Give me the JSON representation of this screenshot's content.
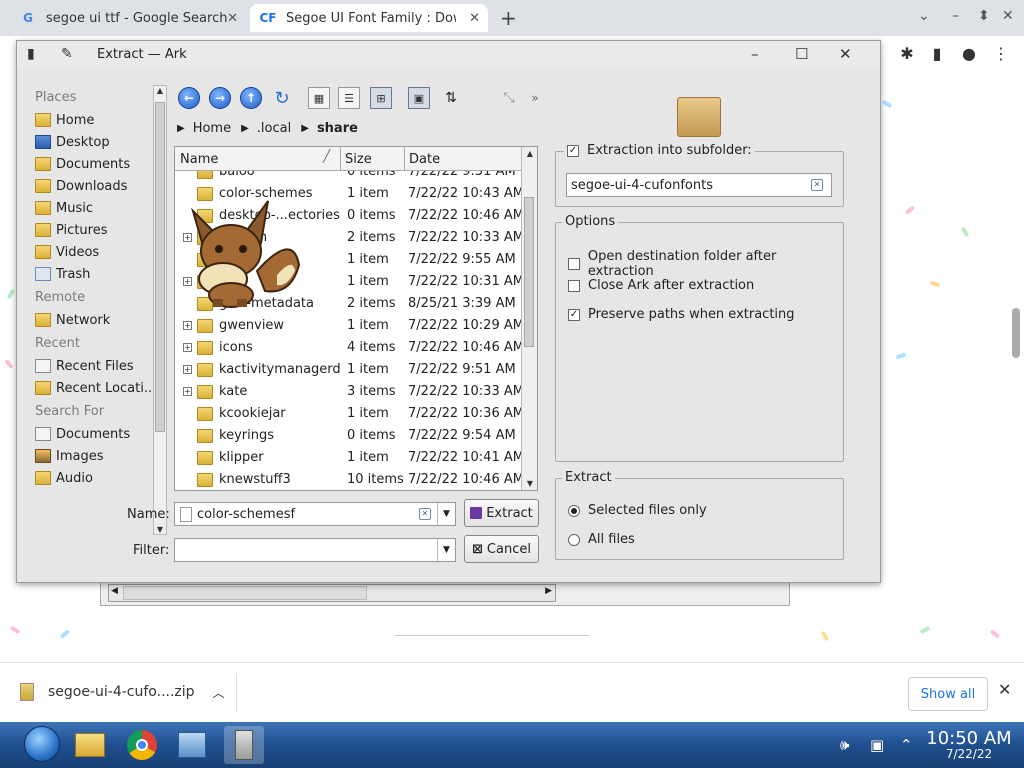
{
  "browser": {
    "tabs": [
      {
        "icon": "G",
        "title": "segoe ui ttf - Google Search"
      },
      {
        "icon": "CF",
        "title": "Segoe UI Font Family : Down"
      }
    ],
    "new_tab": "+"
  },
  "dialog": {
    "title": "Extract — Ark",
    "places": {
      "sections": [
        {
          "label": "Places",
          "items": [
            {
              "label": "Home",
              "icon": "folder-home-icon"
            },
            {
              "label": "Desktop",
              "icon": "desktop-icon"
            },
            {
              "label": "Documents",
              "icon": "folder-icon"
            },
            {
              "label": "Downloads",
              "icon": "folder-icon"
            },
            {
              "label": "Music",
              "icon": "folder-icon"
            },
            {
              "label": "Pictures",
              "icon": "folder-icon"
            },
            {
              "label": "Videos",
              "icon": "folder-icon"
            },
            {
              "label": "Trash",
              "icon": "trash-icon"
            }
          ]
        },
        {
          "label": "Remote",
          "items": [
            {
              "label": "Network",
              "icon": "folder-icon"
            }
          ]
        },
        {
          "label": "Recent",
          "items": [
            {
              "label": "Recent Files",
              "icon": "document-icon"
            },
            {
              "label": "Recent Locati...",
              "icon": "folder-icon"
            }
          ]
        },
        {
          "label": "Search For",
          "items": [
            {
              "label": "Documents",
              "icon": "document-icon"
            },
            {
              "label": "Images",
              "icon": "image-icon"
            },
            {
              "label": "Audio",
              "icon": "folder-icon"
            }
          ]
        }
      ]
    },
    "breadcrumb": [
      "Home",
      ".local",
      "share"
    ],
    "columns": {
      "name": "Name",
      "size": "Size",
      "date": "Date"
    },
    "files": [
      {
        "name": "baloo",
        "size": "0 items",
        "date": "7/22/22 9:51 AM",
        "expander": false
      },
      {
        "name": "color-schemes",
        "size": "1 item",
        "date": "7/22/22 10:43 AM",
        "expander": false
      },
      {
        "name": "desktop-...ectories",
        "size": "0 items",
        "date": "7/22/22 10:46 AM",
        "expander": false
      },
      {
        "name": "dolphin",
        "size": "2 items",
        "date": "7/22/22 10:33 AM",
        "expander": true
      },
      {
        "name": "",
        "size": "1 item",
        "date": "7/22/22 9:55 AM",
        "expander": false
      },
      {
        "name": "",
        "size": "1 item",
        "date": "7/22/22 10:31 AM",
        "expander": true
      },
      {
        "name": "gvfs-metadata",
        "size": "2 items",
        "date": "8/25/21 3:39 AM",
        "expander": false
      },
      {
        "name": "gwenview",
        "size": "1 item",
        "date": "7/22/22 10:29 AM",
        "expander": true
      },
      {
        "name": "icons",
        "size": "4 items",
        "date": "7/22/22 10:46 AM",
        "expander": true
      },
      {
        "name": "kactivitymanagerd",
        "size": "1 item",
        "date": "7/22/22 9:51 AM",
        "expander": true
      },
      {
        "name": "kate",
        "size": "3 items",
        "date": "7/22/22 10:33 AM",
        "expander": true
      },
      {
        "name": "kcookiejar",
        "size": "1 item",
        "date": "7/22/22 10:36 AM",
        "expander": false
      },
      {
        "name": "keyrings",
        "size": "0 items",
        "date": "7/22/22 9:54 AM",
        "expander": false
      },
      {
        "name": "klipper",
        "size": "1 item",
        "date": "7/22/22 10:41 AM",
        "expander": false
      },
      {
        "name": "knewstuff3",
        "size": "10 items",
        "date": "7/22/22 10:46 AM",
        "expander": false
      }
    ],
    "name_label": "Name:",
    "name_value": "color-schemesf",
    "filter_label": "Filter:",
    "filter_value": "",
    "extract_button": "Extract",
    "cancel_button": "Cancel",
    "subfolder": {
      "label": "Extraction into subfolder:",
      "checked": true,
      "value": "segoe-ui-4-cufonfonts"
    },
    "options": {
      "title": "Options",
      "items": [
        {
          "label": "Open destination folder after extraction",
          "checked": false
        },
        {
          "label": "Close Ark after extraction",
          "checked": false
        },
        {
          "label": "Preserve paths when extracting",
          "checked": true
        }
      ]
    },
    "extract_group": {
      "title": "Extract",
      "items": [
        {
          "label": "Selected files only",
          "selected": true
        },
        {
          "label": "All files",
          "selected": false
        }
      ]
    }
  },
  "downloads": {
    "file": "segoe-ui-4-cufo....zip",
    "show_all": "Show all"
  },
  "taskbar": {
    "time": "10:50 AM",
    "date": "7/22/22"
  }
}
